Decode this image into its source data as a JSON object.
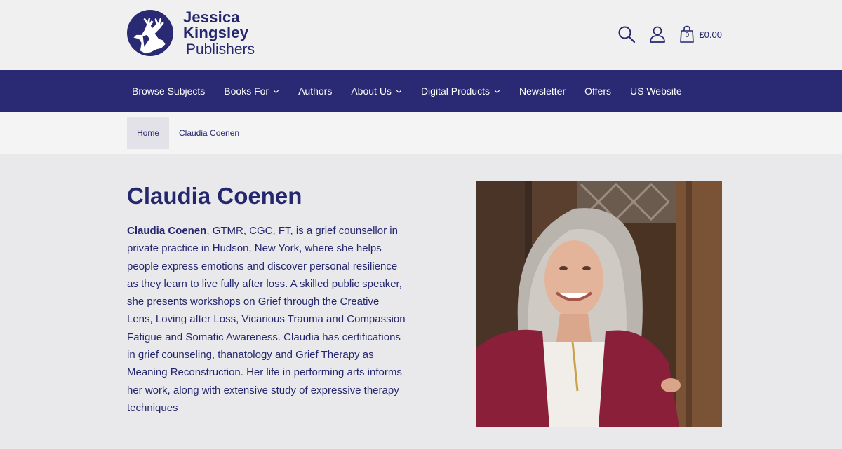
{
  "brand": {
    "name_line1": "Jessica Kingsley",
    "name_line2": "Publishers",
    "primary_color": "#292a73",
    "text_color": "#25276e"
  },
  "header": {
    "cart_count": "0",
    "cart_total": "£0.00",
    "icons": [
      "search-icon",
      "account-icon",
      "shopping-bag-icon"
    ]
  },
  "nav": {
    "items": [
      {
        "label": "Browse Subjects",
        "has_dropdown": false
      },
      {
        "label": "Books For",
        "has_dropdown": true
      },
      {
        "label": "Authors",
        "has_dropdown": false
      },
      {
        "label": "About Us",
        "has_dropdown": true
      },
      {
        "label": "Digital Products",
        "has_dropdown": true
      },
      {
        "label": "Newsletter",
        "has_dropdown": false
      },
      {
        "label": "Offers",
        "has_dropdown": false
      },
      {
        "label": "US Website",
        "has_dropdown": false
      }
    ]
  },
  "breadcrumb": {
    "home": "Home",
    "current": "Claudia Coenen"
  },
  "author": {
    "name": "Claudia Coenen",
    "bio_name": "Claudia Coenen",
    "bio_rest": ", GTMR, CGC, FT, is a grief counsellor in private practice in Hudson, New York, where she helps people express emotions and discover personal resilience as they learn to live fully after loss. A skilled public speaker, she presents workshops on Grief through the Creative Lens, Loving after Loss, Vicarious Trauma and Compassion Fatigue and Somatic Awareness. Claudia has certifications in grief counseling, thanatology and Grief Therapy as Meaning Reconstruction. Her life in performing arts informs her work, along with extensive study of expressive therapy techniques"
  }
}
